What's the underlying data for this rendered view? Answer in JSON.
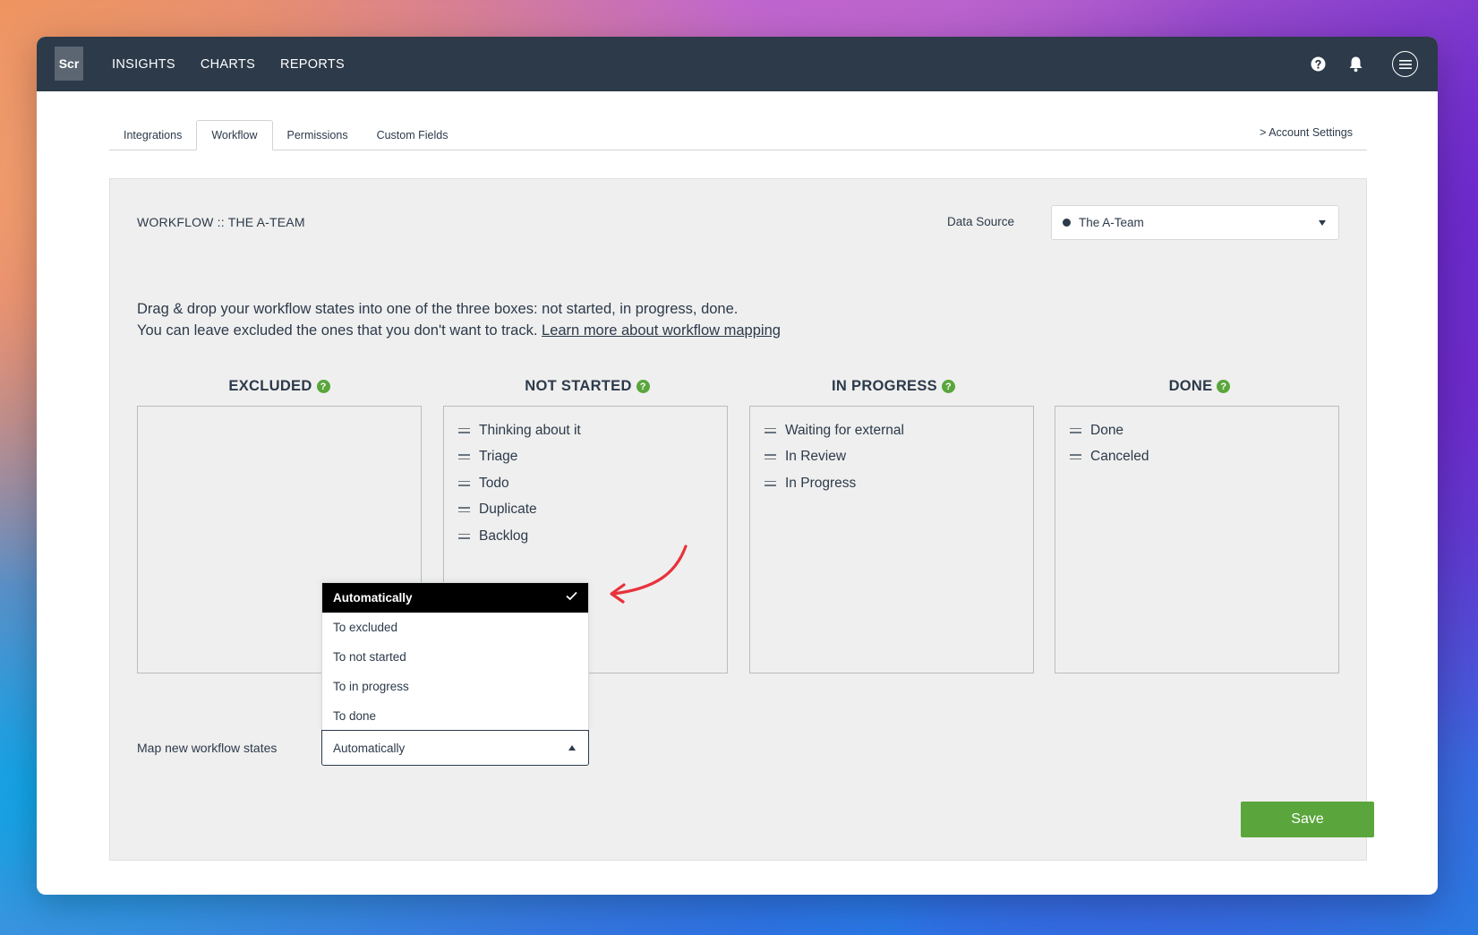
{
  "app": {
    "logo_text": "Scr",
    "nav": [
      "INSIGHTS",
      "CHARTS",
      "REPORTS"
    ]
  },
  "top_icons": [
    "help-icon",
    "bell-icon",
    "menu-icon"
  ],
  "tabs": [
    "Integrations",
    "Workflow",
    "Permissions",
    "Custom Fields"
  ],
  "active_tab": "Workflow",
  "account_settings_link": "> Account Settings",
  "workflow": {
    "title": "WORKFLOW :: THE A-TEAM",
    "data_source_label": "Data Source",
    "data_source_value": "The A-Team",
    "instructions_line1": "Drag & drop your workflow states into one of the three boxes: not started, in progress, done.",
    "instructions_line2": "You can leave excluded the ones that you don't want to track.",
    "learn_more_link": "Learn more about workflow mapping"
  },
  "columns": [
    {
      "title": "EXCLUDED",
      "help": "?",
      "states": []
    },
    {
      "title": "NOT STARTED",
      "help": "?",
      "states": [
        "Thinking about it",
        "Triage",
        "Todo",
        "Duplicate",
        "Backlog"
      ]
    },
    {
      "title": "IN PROGRESS",
      "help": "?",
      "states": [
        "Waiting for external",
        "In Review",
        "In Progress"
      ]
    },
    {
      "title": "DONE",
      "help": "?",
      "states": [
        "Done",
        "Canceled"
      ]
    }
  ],
  "map_new": {
    "label": "Map new workflow states",
    "value": "Automatically",
    "options": [
      "Automatically",
      "To excluded",
      "To not started",
      "To in progress",
      "To done"
    ],
    "selected_index": 0
  },
  "save_label": "Save",
  "colors": {
    "topbar": "#2c3a4a",
    "accent_green": "#5aa63c",
    "annotation_arrow": "#e8323c"
  }
}
